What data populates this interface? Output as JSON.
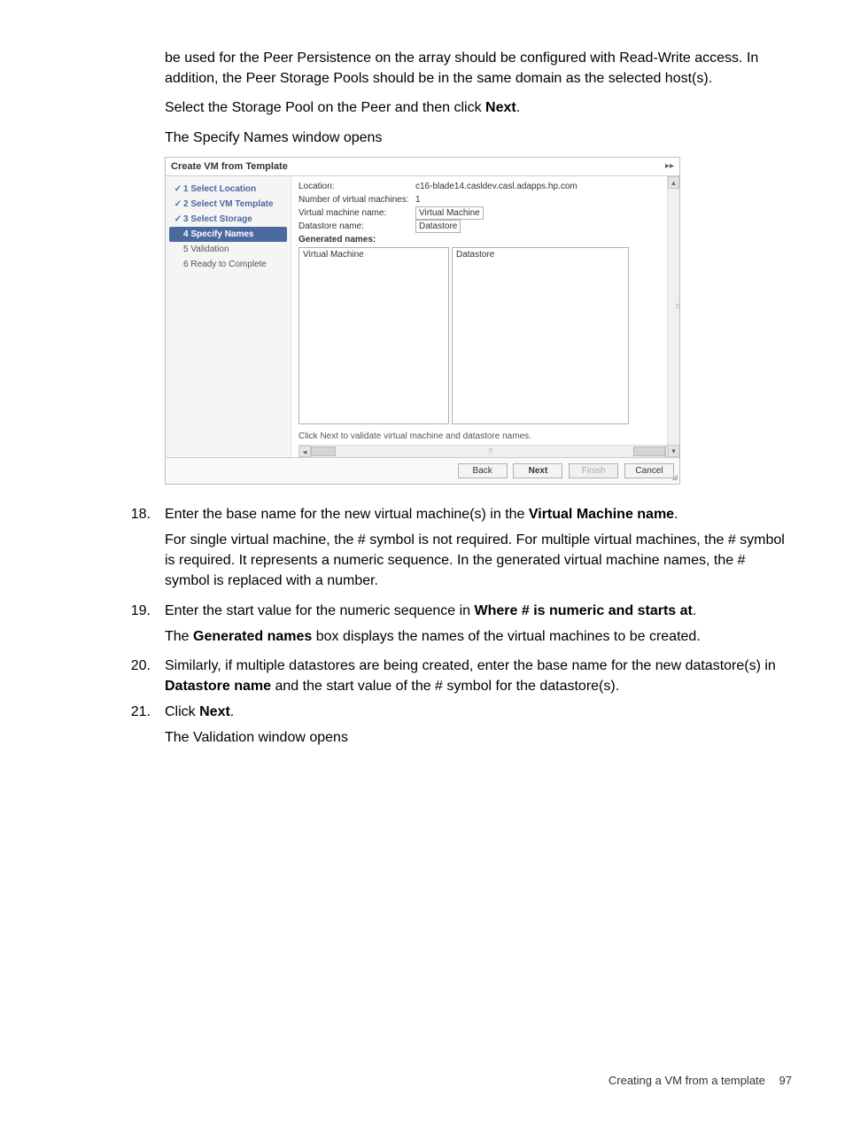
{
  "intro": {
    "p1": "be used for the Peer Persistence on the array should be configured with Read-Write access. In addition, the Peer Storage Pools should be in the same domain as the selected host(s).",
    "p2_pre": "Select the Storage Pool on the Peer and then click ",
    "p2_b": "Next",
    "p2_post": ".",
    "p3": "The Specify Names window opens"
  },
  "win": {
    "title": "Create VM from Template",
    "steps": [
      {
        "num": "1",
        "label": "Select Location",
        "state": "done"
      },
      {
        "num": "2",
        "label": "Select VM Template",
        "state": "done"
      },
      {
        "num": "3",
        "label": "Select Storage",
        "state": "done"
      },
      {
        "num": "4",
        "label": "Specify Names",
        "state": "current"
      },
      {
        "num": "5",
        "label": "Validation",
        "state": "pending"
      },
      {
        "num": "6",
        "label": "Ready to Complete",
        "state": "pending"
      }
    ],
    "location_label": "Location:",
    "location_val": "c16-blade14.casldev.casl.adapps.hp.com",
    "numvm_label": "Number of virtual machines:",
    "numvm_val": "1",
    "vmname_label": "Virtual machine name:",
    "vmname_val": "Virtual Machine",
    "dsname_label": "Datastore name:",
    "dsname_val": "Datastore",
    "gen_label": "Generated names:",
    "gen_col1_header": "Virtual Machine",
    "gen_col2_header": "Datastore",
    "hint": "Click Next to validate virtual machine and datastore names.",
    "buttons": {
      "back": "Back",
      "next": "Next",
      "finish": "Finish",
      "cancel": "Cancel"
    }
  },
  "steps": {
    "s18": {
      "num": "18.",
      "line1_pre": "Enter the base name for the new virtual machine(s) in the ",
      "line1_b": "Virtual Machine name",
      "line1_post": ".",
      "line2": "For single virtual machine, the # symbol is not required. For multiple virtual machines, the # symbol is required. It represents a numeric sequence. In the generated virtual machine names, the # symbol is replaced with a number."
    },
    "s19": {
      "num": "19.",
      "line1_pre": "Enter the start value for the numeric sequence in ",
      "line1_b": "Where # is numeric and starts at",
      "line1_post": ".",
      "line2_pre": "The ",
      "line2_b": "Generated names",
      "line2_post": " box displays the names of the virtual machines to be created."
    },
    "s20": {
      "num": "20.",
      "line1_pre": "Similarly, if multiple datastores are being created, enter the base name for the new datastore(s) in ",
      "line1_b": "Datastore name",
      "line1_mid": "  and the start value of the # symbol for the datastore(s)."
    },
    "s21": {
      "num": "21.",
      "line1_pre": "Click ",
      "line1_b": "Next",
      "line1_post": ".",
      "line2": "The Validation window opens"
    }
  },
  "footer": {
    "text": "Creating a VM from a template",
    "page": "97"
  }
}
